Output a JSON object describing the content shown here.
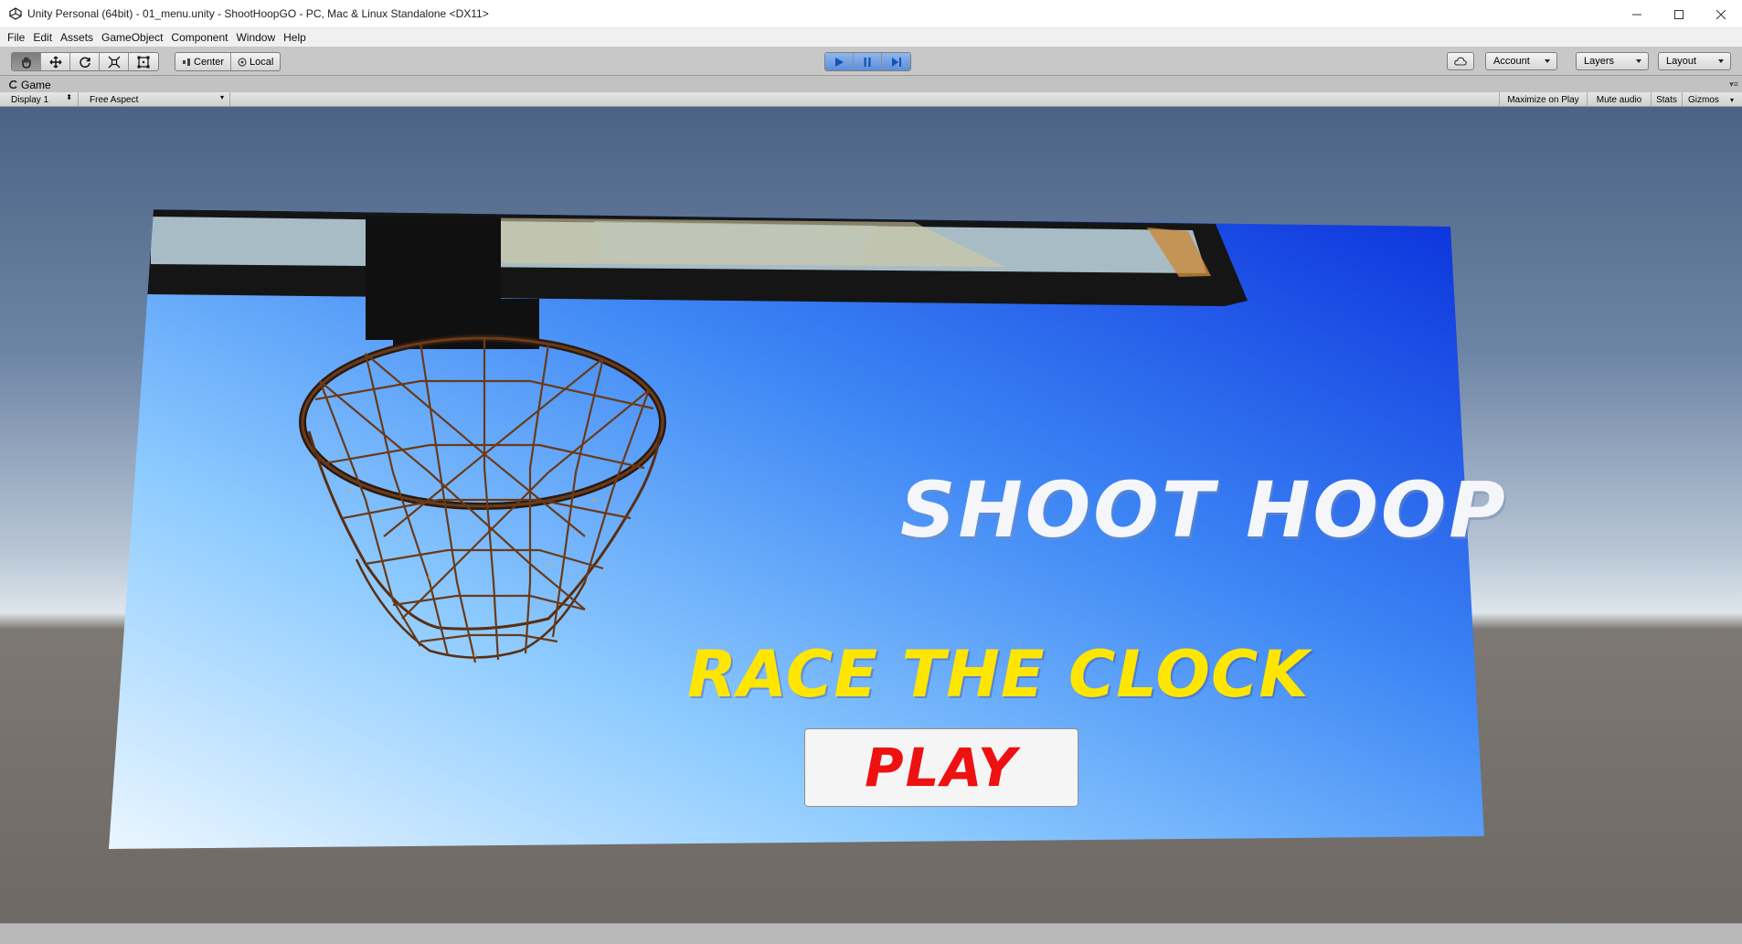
{
  "window": {
    "title": "Unity Personal (64bit) - 01_menu.unity - ShootHoopGO - PC, Mac & Linux Standalone <DX11>",
    "controls": [
      "minimize-icon",
      "maximize-icon",
      "close-icon"
    ]
  },
  "menu": [
    "File",
    "Edit",
    "Assets",
    "GameObject",
    "Component",
    "Window",
    "Help"
  ],
  "toolbar": {
    "tools": [
      "hand-icon",
      "move-icon",
      "rotate-icon",
      "scale-icon",
      "rect-tool-icon"
    ],
    "pivot_center": "Center",
    "pivot_local": "Local",
    "play_controls": [
      "play-icon",
      "pause-icon",
      "step-icon"
    ],
    "play_active": true,
    "account": "Account",
    "layers": "Layers",
    "layout": "Layout",
    "cloud_icon": "cloud-icon"
  },
  "game_panel": {
    "tab_label": "Game",
    "display": "Display 1",
    "aspect": "Free Aspect",
    "maximize_on_play": "Maximize on Play",
    "mute_audio": "Mute audio",
    "stats": "Stats",
    "gizmos": "Gizmos"
  },
  "scene": {
    "title": "SHOOT HOOP",
    "subtitle": "RACE THE CLOCK",
    "play_button": "PLAY",
    "colors": {
      "sky_blue": "#1a4ff0",
      "sky_light": "#cfe9ff",
      "title_color": "#f4f6fa",
      "subtitle_color": "#ffe600",
      "play_text_color": "#ee1111"
    }
  }
}
